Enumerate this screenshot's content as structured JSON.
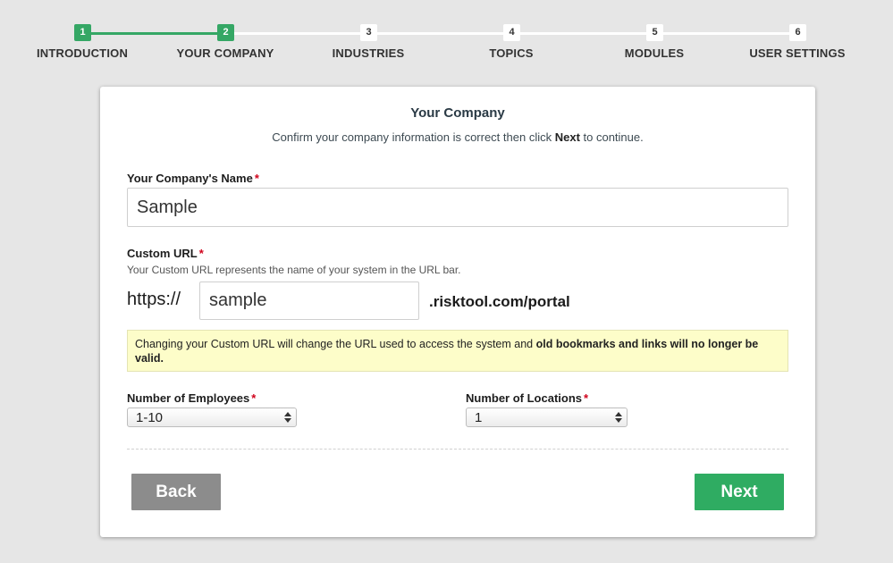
{
  "colors": {
    "accent": "#35a765",
    "next_button": "#2fac62",
    "back_button": "#8c8c8c",
    "warning_bg": "#fdfdc9"
  },
  "stepper": {
    "current_step": 2,
    "steps": [
      {
        "number": "1",
        "label": "INTRODUCTION",
        "status": "complete"
      },
      {
        "number": "2",
        "label": "YOUR COMPANY",
        "status": "current"
      },
      {
        "number": "3",
        "label": "INDUSTRIES",
        "status": "upcoming"
      },
      {
        "number": "4",
        "label": "TOPICS",
        "status": "upcoming"
      },
      {
        "number": "5",
        "label": "MODULES",
        "status": "upcoming"
      },
      {
        "number": "6",
        "label": "USER SETTINGS",
        "status": "upcoming"
      }
    ]
  },
  "form": {
    "title": "Your Company",
    "subtitle_before": "Confirm your company information is correct then click ",
    "subtitle_bold": "Next",
    "subtitle_after": " to continue.",
    "required_marker": "*",
    "company_name": {
      "label": "Your Company's Name",
      "value": "Sample"
    },
    "custom_url": {
      "label": "Custom URL",
      "help": "Your Custom URL represents the name of your system in the URL bar.",
      "prefix": "https://",
      "value": "sample",
      "suffix": ".risktool.com/portal"
    },
    "warning": {
      "text_before": "Changing your Custom URL will change the URL used to access the system and ",
      "text_bold": "old bookmarks and links will no longer be valid."
    },
    "employees": {
      "label": "Number of Employees",
      "selected": "1-10"
    },
    "locations": {
      "label": "Number of Locations",
      "selected": "1"
    },
    "back_label": "Back",
    "next_label": "Next"
  }
}
